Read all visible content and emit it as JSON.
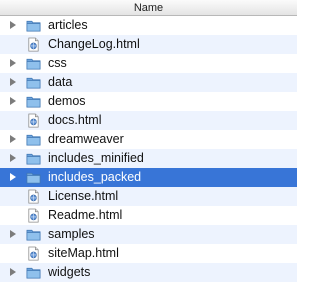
{
  "header": {
    "column_label": "Name"
  },
  "colors": {
    "alt_row": "#edf3fe",
    "selection": "#3875d7",
    "folder": "#7fb2e5",
    "disclosure": "#7c7c7c"
  },
  "items": [
    {
      "label": "articles",
      "type": "folder",
      "selected": false
    },
    {
      "label": "ChangeLog.html",
      "type": "html-file",
      "selected": false
    },
    {
      "label": "css",
      "type": "folder",
      "selected": false
    },
    {
      "label": "data",
      "type": "folder",
      "selected": false
    },
    {
      "label": "demos",
      "type": "folder",
      "selected": false
    },
    {
      "label": "docs.html",
      "type": "html-file",
      "selected": false
    },
    {
      "label": "dreamweaver",
      "type": "folder",
      "selected": false
    },
    {
      "label": "includes_minified",
      "type": "folder",
      "selected": false
    },
    {
      "label": "includes_packed",
      "type": "folder",
      "selected": true
    },
    {
      "label": "License.html",
      "type": "html-file",
      "selected": false
    },
    {
      "label": "Readme.html",
      "type": "html-file",
      "selected": false
    },
    {
      "label": "samples",
      "type": "folder",
      "selected": false
    },
    {
      "label": "siteMap.html",
      "type": "html-file",
      "selected": false
    },
    {
      "label": "widgets",
      "type": "folder",
      "selected": false
    }
  ]
}
